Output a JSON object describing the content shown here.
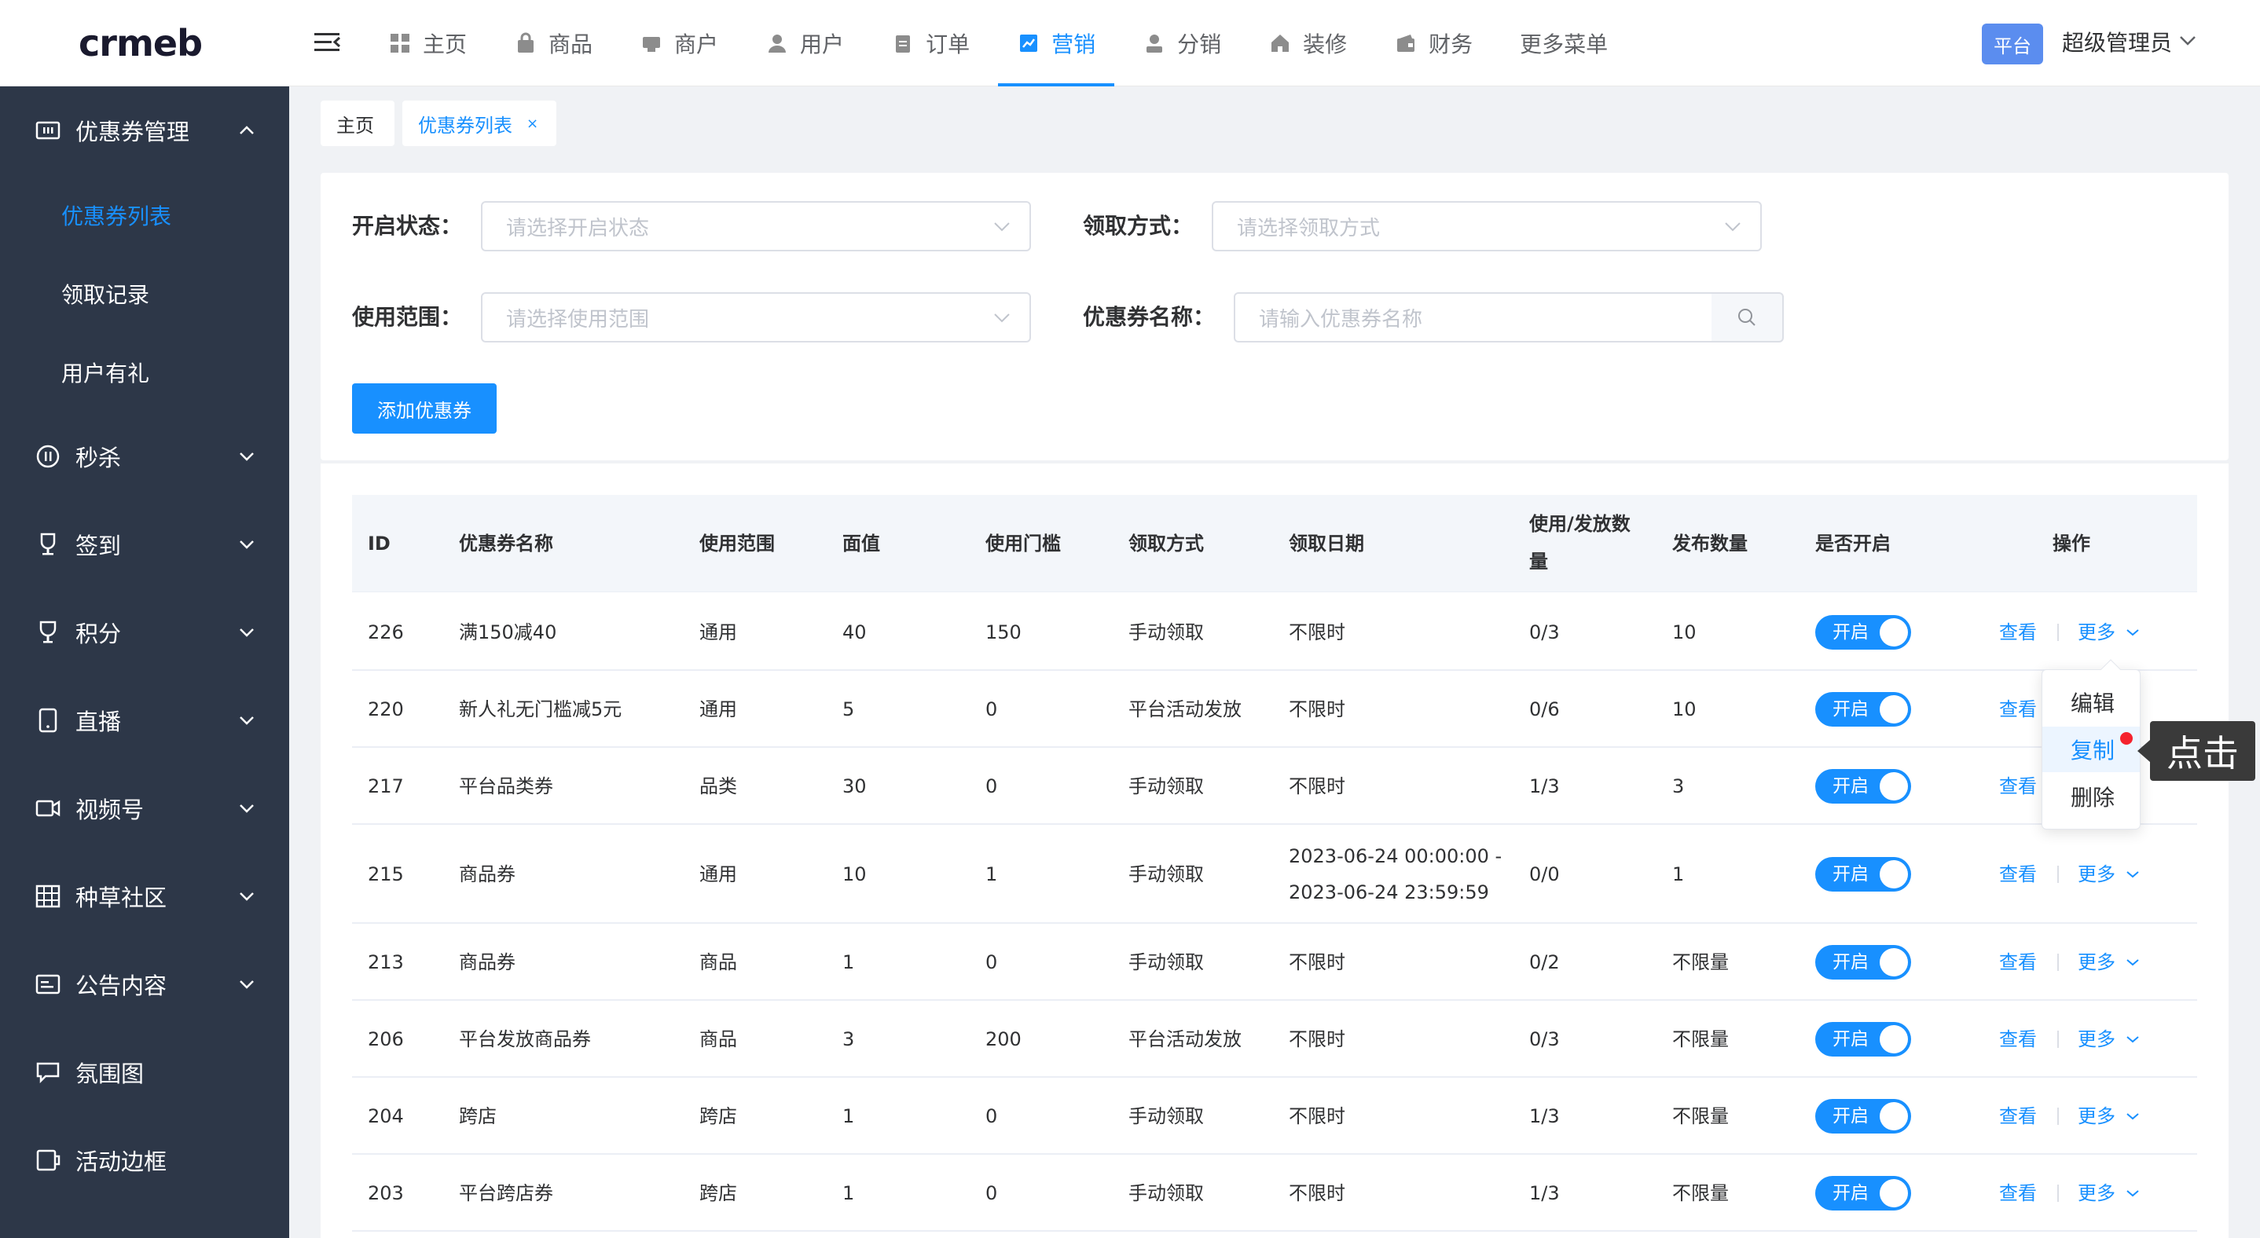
{
  "header": {
    "logo": "crmeb",
    "nav": [
      {
        "label": "主页",
        "icon": "grid-icon"
      },
      {
        "label": "商品",
        "icon": "bag-icon"
      },
      {
        "label": "商户",
        "icon": "store-icon"
      },
      {
        "label": "用户",
        "icon": "user-icon"
      },
      {
        "label": "订单",
        "icon": "clipboard-icon"
      },
      {
        "label": "营销",
        "icon": "chart-icon",
        "active": true
      },
      {
        "label": "分销",
        "icon": "person-icon"
      },
      {
        "label": "装修",
        "icon": "home-icon"
      },
      {
        "label": "财务",
        "icon": "wallet-icon"
      },
      {
        "label": "更多菜单",
        "icon": ""
      }
    ],
    "platform_badge": "平台",
    "admin_name": "超级管理员"
  },
  "sidebar": {
    "group_title": "优惠券管理",
    "sub_items": [
      "优惠券列表",
      "领取记录",
      "用户有礼"
    ],
    "items": [
      {
        "label": "秒杀",
        "icon": "timer-icon"
      },
      {
        "label": "签到",
        "icon": "trophy-icon"
      },
      {
        "label": "积分",
        "icon": "medal-icon"
      },
      {
        "label": "直播",
        "icon": "tablet-icon"
      },
      {
        "label": "视频号",
        "icon": "video-icon"
      },
      {
        "label": "种草社区",
        "icon": "grid-table-icon"
      },
      {
        "label": "公告内容",
        "icon": "notice-icon"
      },
      {
        "label": "氛围图",
        "icon": "chat-icon"
      },
      {
        "label": "活动边框",
        "icon": "frame-icon"
      }
    ]
  },
  "tabs": [
    {
      "label": "主页"
    },
    {
      "label": "优惠券列表",
      "close": "×"
    }
  ],
  "filters": {
    "status_label": "开启状态：",
    "status_placeholder": "请选择开启状态",
    "method_label": "领取方式：",
    "method_placeholder": "请选择领取方式",
    "scope_label": "使用范围：",
    "scope_placeholder": "请选择使用范围",
    "name_label": "优惠券名称：",
    "name_placeholder": "请输入优惠券名称",
    "add_button": "添加优惠券"
  },
  "table": {
    "headers": {
      "id": "ID",
      "name": "优惠券名称",
      "scope": "使用范围",
      "value": "面值",
      "threshold": "使用门槛",
      "method": "领取方式",
      "date": "领取日期",
      "usage_line1": "使用/发放数",
      "usage_line2": "量",
      "count": "发布数量",
      "enabled": "是否开启",
      "actions": "操作"
    },
    "rows": [
      {
        "id": "226",
        "name": "满150减40",
        "scope": "通用",
        "value": "40",
        "threshold": "150",
        "method": "手动领取",
        "date": "不限时",
        "date2": "",
        "usage": "0/3",
        "count": "10",
        "toggle": "开启",
        "view": "查看",
        "more": "更多"
      },
      {
        "id": "220",
        "name": "新人礼无门槛减5元",
        "scope": "通用",
        "value": "5",
        "threshold": "0",
        "method": "平台活动发放",
        "date": "不限时",
        "date2": "",
        "usage": "0/6",
        "count": "10",
        "toggle": "开启",
        "view": "查看",
        "more": ""
      },
      {
        "id": "217",
        "name": "平台品类券",
        "scope": "品类",
        "value": "30",
        "threshold": "0",
        "method": "手动领取",
        "date": "不限时",
        "date2": "",
        "usage": "1/3",
        "count": "3",
        "toggle": "开启",
        "view": "查看",
        "more": ""
      },
      {
        "id": "215",
        "name": "商品券",
        "scope": "通用",
        "value": "10",
        "threshold": "1",
        "method": "手动领取",
        "date": "2023-06-24 00:00:00 -",
        "date2": "2023-06-24 23:59:59",
        "usage": "0/0",
        "count": "1",
        "toggle": "开启",
        "view": "查看",
        "more": "更多"
      },
      {
        "id": "213",
        "name": "商品券",
        "scope": "商品",
        "value": "1",
        "threshold": "0",
        "method": "手动领取",
        "date": "不限时",
        "date2": "",
        "usage": "0/2",
        "count": "不限量",
        "toggle": "开启",
        "view": "查看",
        "more": "更多"
      },
      {
        "id": "206",
        "name": "平台发放商品券",
        "scope": "商品",
        "value": "3",
        "threshold": "200",
        "method": "平台活动发放",
        "date": "不限时",
        "date2": "",
        "usage": "0/3",
        "count": "不限量",
        "toggle": "开启",
        "view": "查看",
        "more": "更多"
      },
      {
        "id": "204",
        "name": "跨店",
        "scope": "跨店",
        "value": "1",
        "threshold": "0",
        "method": "手动领取",
        "date": "不限时",
        "date2": "",
        "usage": "1/3",
        "count": "不限量",
        "toggle": "开启",
        "view": "查看",
        "more": "更多"
      },
      {
        "id": "203",
        "name": "平台跨店券",
        "scope": "跨店",
        "value": "1",
        "threshold": "0",
        "method": "手动领取",
        "date": "不限时",
        "date2": "",
        "usage": "1/3",
        "count": "不限量",
        "toggle": "开启",
        "view": "查看",
        "more": "更多"
      }
    ]
  },
  "dropdown": {
    "items": [
      "编辑",
      "复制",
      "删除"
    ],
    "hovered": "复制"
  },
  "click_tip": "点击",
  "colors": {
    "primary": "#1890ff",
    "sidebar_bg": "#2d3748",
    "badge": "#5b8def"
  }
}
